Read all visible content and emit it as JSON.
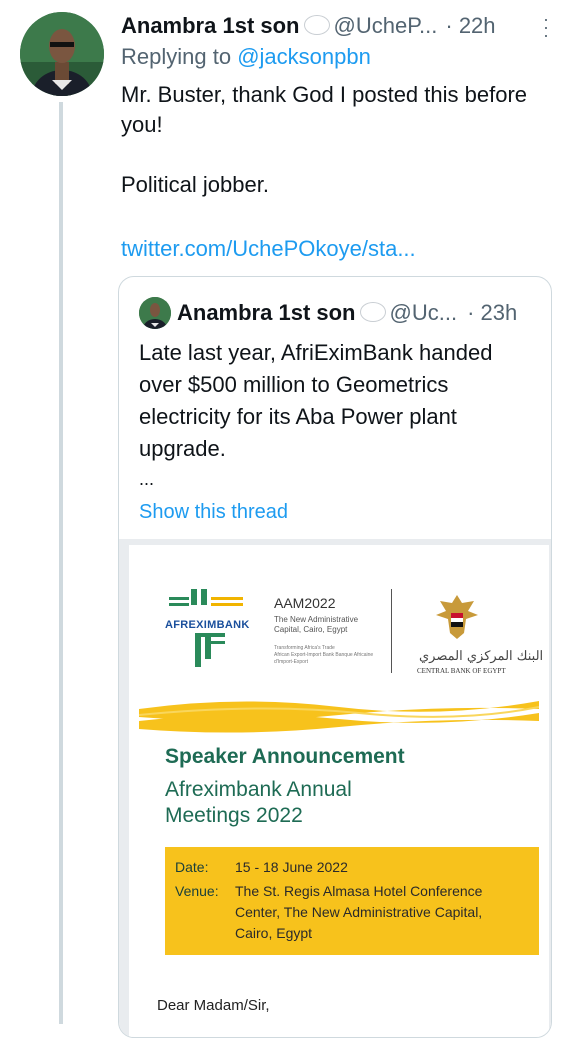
{
  "reply": {
    "display_name": "Anambra 1st son",
    "handle": "@UcheP...",
    "time": "· 22h",
    "replying_prefix": "Replying to ",
    "replying_to": "@jacksonpbn",
    "text": "Mr. Buster, thank God I posted this before you!\n\nPolitical jobber.",
    "link": "twitter.com/UchePOkoye/sta..."
  },
  "quote": {
    "display_name": "Anambra 1st son",
    "handle": "@Uc...",
    "time": "· 23h",
    "text": "Late last year, AfriEximBank handed over $500 million to Geometrics electricity for its Aba Power plant upgrade.",
    "ellipsis": "...",
    "show_thread": "Show this thread"
  },
  "document": {
    "logo_text": "AFREXIMBANK",
    "aam_title": "AAM2022",
    "aam_subtitle": "The New Administrative Capital, Cairo, Egypt",
    "aam_tagline": "Transforming Africa's Trade",
    "aam_small": "African Export-Import Bank Banque Africaine d'Import-Export",
    "cbe_arabic": "البنك المركزي المصري",
    "cbe_english": "CENTRAL BANK OF EGYPT",
    "heading": "Speaker Announcement",
    "meeting_line1": "Afreximbank Annual",
    "meeting_line2": "Meetings 2022",
    "date_label": "Date:",
    "date_value": "15 - 18 June 2022",
    "venue_label": "Venue:",
    "venue_line1": "The St. Regis Almasa Hotel Conference",
    "venue_line2": "Center, The New Administrative Capital,",
    "venue_line3": "Cairo, Egypt",
    "salutation": "Dear Madam/Sir,"
  },
  "colors": {
    "link": "#1d9bf0",
    "secondary_text": "#536471",
    "afx_green": "#1e6b54",
    "afx_yellow": "#f7c21c"
  },
  "icons": [
    "avatar",
    "thought-bubble-icon",
    "more-options-icon",
    "afreximbank-logo-icon",
    "egypt-eagle-emblem-icon"
  ]
}
